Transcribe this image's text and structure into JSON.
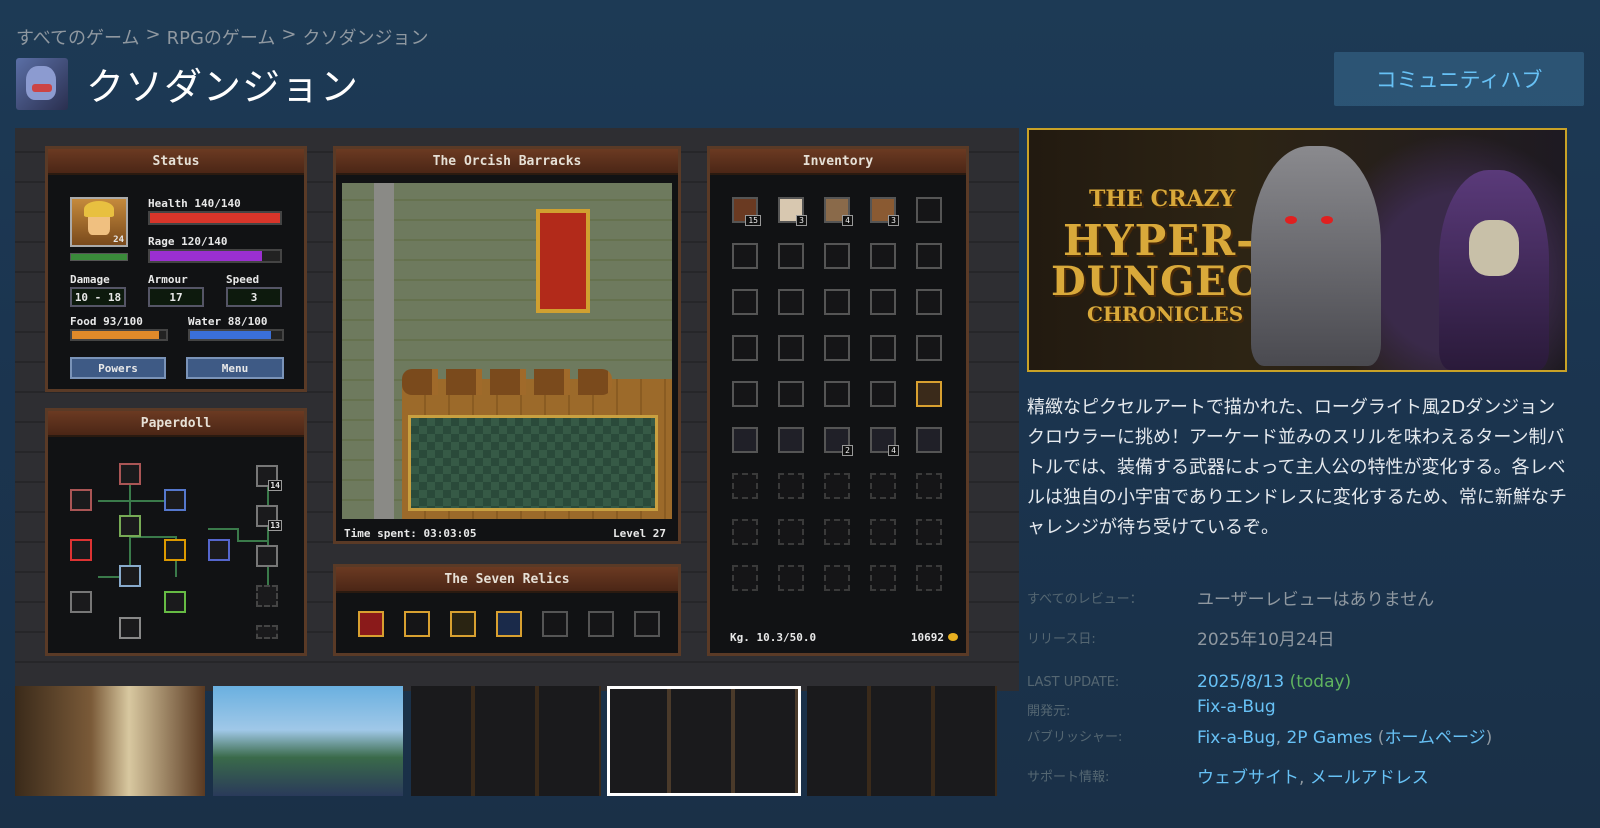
{
  "breadcrumb": {
    "items": [
      "すべてのゲーム",
      "RPGのゲーム",
      "クソダンジョン"
    ],
    "separator": ">"
  },
  "page": {
    "title": "クソダンジョン",
    "community_button": "コミュニティハブ"
  },
  "screenshot": {
    "status_panel": {
      "title": "Status",
      "portrait_level": "24",
      "health": "Health 140/140",
      "health_fraction": 1.0,
      "rage": "Rage 120/140",
      "rage_fraction": 0.86,
      "damage_label": "Damage",
      "damage_value": "10 - 18",
      "armour_label": "Armour",
      "armour_value": "17",
      "speed_label": "Speed",
      "speed_value": "3",
      "food": "Food 93/100",
      "food_fraction": 0.93,
      "water": "Water 88/100",
      "water_fraction": 0.88,
      "powers_button": "Powers",
      "menu_button": "Menu"
    },
    "paperdoll_panel": {
      "title": "Paperdoll",
      "counts": [
        "14",
        "13"
      ]
    },
    "map_panel": {
      "title": "The Orcish Barracks",
      "time_spent": "Time spent: 03:03:05",
      "level": "Level 27"
    },
    "relics_panel": {
      "title": "The Seven Relics"
    },
    "inventory_panel": {
      "title": "Inventory",
      "item_counts": [
        "15",
        "3",
        "4",
        "3",
        "2",
        "4"
      ],
      "weight": "Kg. 10.3/50.0",
      "gold": "10692"
    }
  },
  "header_image": {
    "line1": "THE CRAZY",
    "line2": "HYPER-",
    "line3": "DUNGEON",
    "line4": "CHRONICLES"
  },
  "description": "精緻なピクセルアートで描かれた、ローグライト風2Dダンジョンクロウラーに挑め！アーケード並みのスリルを味わえるターン制バトルでは、装備する武器によって主人公の特性が変化する。各レベルは独自の小宇宙でありエンドレスに変化するため、常に新鮮なチャレンジが待ち受けているぞ。",
  "info": {
    "reviews_label": "すべてのレビュー：",
    "reviews_value": "ユーザーレビューはありません",
    "release_label": "リリース日:",
    "release_value": "2025年10月24日",
    "update_label": "LAST UPDATE:",
    "update_value": "2025/8/13",
    "update_note": "(today)",
    "developer_label": "開発元:",
    "developer_value": "Fix-a-Bug",
    "publisher_label": "パブリッシャー:",
    "publisher_value1": "Fix-a-Bug",
    "publisher_value2": "2P Games",
    "publisher_homepage": "ホームページ",
    "support_label": "サポート情報:",
    "support_website": "ウェブサイト",
    "support_email": "メールアドレス"
  },
  "colors": {
    "accent_link": "#67c1f5",
    "today_green": "#5fb35f",
    "health": "#d8352a",
    "rage": "#9b2fd0",
    "food": "#e08a2a",
    "water": "#3a6fd8"
  }
}
